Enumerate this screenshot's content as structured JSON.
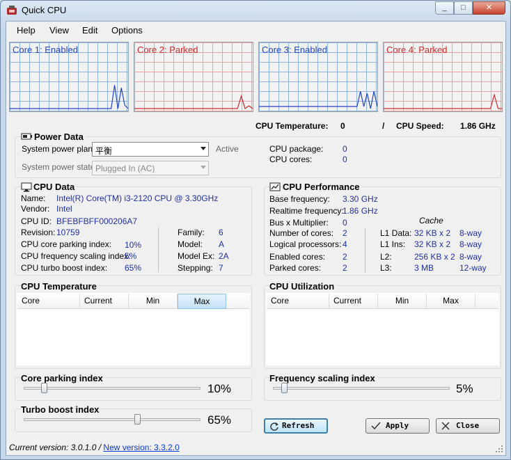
{
  "window": {
    "title": "Quick CPU",
    "min_glyph": "_",
    "max_glyph": "□",
    "close_glyph": "✕"
  },
  "menu": [
    "Help",
    "View",
    "Edit",
    "Options"
  ],
  "core_graphs": [
    {
      "label": "Core 1: Enabled",
      "color": "#2244c8",
      "samples": [
        0,
        0,
        0,
        0,
        0,
        0,
        0,
        0,
        0,
        0,
        0,
        0,
        0,
        0,
        0,
        0,
        0,
        0,
        0,
        0,
        0,
        0,
        0,
        0,
        0,
        0,
        0,
        0,
        0,
        0,
        0,
        0.34,
        0,
        0.3,
        0.05,
        0
      ]
    },
    {
      "label": "Core 2: Parked",
      "color": "#d22a2a",
      "samples": [
        0,
        0,
        0,
        0,
        0,
        0,
        0,
        0,
        0,
        0,
        0,
        0,
        0,
        0,
        0,
        0,
        0,
        0,
        0,
        0,
        0,
        0,
        0,
        0,
        0,
        0,
        0,
        0,
        0.18,
        0,
        0.04,
        0
      ]
    },
    {
      "label": "Core 3: Enabled",
      "color": "#2244c8",
      "samples": [
        0.03,
        0.03,
        0.03,
        0.03,
        0.03,
        0.03,
        0.03,
        0.03,
        0.03,
        0.03,
        0.03,
        0.03,
        0.03,
        0.03,
        0.03,
        0.03,
        0.03,
        0.03,
        0.03,
        0.03,
        0.03,
        0.03,
        0.03,
        0.03,
        0.03,
        0.03,
        0.03,
        0.03,
        0.03,
        0.03,
        0.25,
        0.03,
        0.22,
        0,
        0.25,
        0.03
      ]
    },
    {
      "label": "Core 4: Parked",
      "color": "#d22a2a",
      "samples": [
        0,
        0,
        0,
        0,
        0,
        0,
        0,
        0,
        0,
        0,
        0,
        0,
        0,
        0,
        0,
        0,
        0,
        0,
        0,
        0,
        0,
        0,
        0,
        0,
        0,
        0,
        0,
        0,
        0,
        0.2,
        0,
        0
      ]
    }
  ],
  "summary": {
    "temp_label": "CPU Temperature:",
    "temp_value": "0",
    "slash": "/",
    "speed_label": "CPU Speed:",
    "speed_value": "1.86 GHz"
  },
  "power": {
    "title": "Power Data",
    "plan_label": "System power plan:",
    "plan_value": "平衡",
    "state_label": "System power state:",
    "state_value": "Plugged In (AC)",
    "active_label": "Active",
    "package_label": "CPU package:",
    "package_value": "0",
    "cores_label": "CPU cores:",
    "cores_value": "0"
  },
  "cpu_data": {
    "title": "CPU Data",
    "name_label": "Name:",
    "name_value": "Intel(R) Core(TM) i3-2120 CPU @ 3.30GHz",
    "vendor_label": "Vendor:",
    "vendor_value": "Intel",
    "id_label": "CPU ID:",
    "id_value": "BFEBFBFF000206A7",
    "revision_label": "Revision:",
    "revision_value": "10759",
    "family_label": "Family:",
    "family_value": "6",
    "parking_label": "CPU core parking index:",
    "parking_value": "10%",
    "model_label": "Model:",
    "model_value": "A",
    "freq_label": "CPU frequency scaling index:",
    "freq_value": "5%",
    "modelex_label": "Model Ex:",
    "modelex_value": "2A",
    "turbo_label": "CPU turbo boost index:",
    "turbo_value": "65%",
    "stepping_label": "Stepping:",
    "stepping_value": "7"
  },
  "perf": {
    "title": "CPU Performance",
    "base_label": "Base frequency:",
    "base_value": "3.30 GHz",
    "rt_label": "Realtime frequency:",
    "rt_value": "1.86 GHz",
    "bus_label": "Bus x Multiplier:",
    "bus_value": "0",
    "cache_label": "Cache",
    "cores_label": "Number of cores:",
    "cores_value": "2",
    "logical_label": "Logical processors:",
    "logical_value": "4",
    "enabled_label": "Enabled cores:",
    "enabled_value": "2",
    "parked_label": "Parked cores:",
    "parked_value": "2",
    "l1d_label": "L1 Data:",
    "l1d_size": "32 KB x 2",
    "l1d_way": "8-way",
    "l1i_label": "L1 Ins:",
    "l1i_size": "32 KB x 2",
    "l1i_way": "8-way",
    "l2_label": "L2:",
    "l2_size": "256 KB x 2",
    "l2_way": "8-way",
    "l3_label": "L3:",
    "l3_size": "3 MB",
    "l3_way": "12-way"
  },
  "temp_table": {
    "title": "CPU Temperature",
    "columns": [
      "Core",
      "Current",
      "Min",
      "Max"
    ],
    "sorted_column": "Max"
  },
  "util_table": {
    "title": "CPU Utilization",
    "columns": [
      "Core",
      "Current",
      "Min",
      "Max"
    ]
  },
  "sliders": {
    "parking": {
      "label": "Core parking index",
      "value_text": "10%",
      "fraction": 0.1
    },
    "turbo": {
      "label": "Turbo boost index",
      "value_text": "65%",
      "fraction": 0.65
    },
    "freq": {
      "label": "Frequency scaling index",
      "value_text": "5%",
      "fraction": 0.05
    }
  },
  "buttons": {
    "refresh": "Refresh",
    "apply": "Apply",
    "close": "Close"
  },
  "status": {
    "current": "Current version:  3.0.1.0 /",
    "new_link": "New version: 3.3.2.0"
  }
}
